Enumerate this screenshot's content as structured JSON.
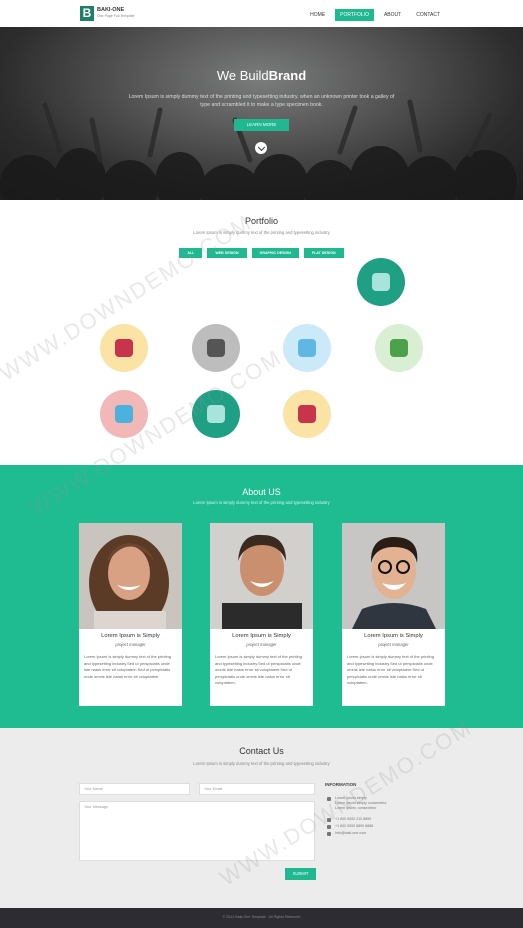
{
  "brand": {
    "letter": "B",
    "name": "BAKI-ONE",
    "tagline": "One Page Full Template"
  },
  "nav": {
    "items": [
      "HOME",
      "PORTFOLIO",
      "ABOUT",
      "CONTACT"
    ],
    "active_index": 1
  },
  "hero": {
    "title_light": "We Build",
    "title_bold": "Brand",
    "text": "Lorem Ipsum is simply dummy text of the printing and typesetting industry. when an unknown printer took a galley of type and scrambled it to make a type specimen book.",
    "button": "LEARN MORE"
  },
  "portfolio": {
    "title": "Portfolio",
    "subtitle": "Lorem Ipsum is simply dummy text of the printing and typesetting industry",
    "filters": [
      "ALL",
      "WEB DESIGN",
      "GRAPHIC DESIGN",
      "FLAT DESIGN"
    ],
    "icons": [
      {
        "name": "camera-icon",
        "bg": "#1f9f84",
        "fg": "#a9e4dc"
      },
      {
        "name": "music-icon",
        "bg": "#fbe3a6",
        "fg": "#c8344c"
      },
      {
        "name": "settings-icon",
        "bg": "#bdbdbd",
        "fg": "#555"
      },
      {
        "name": "download-icon",
        "bg": "#cbe9f8",
        "fg": "#5fb7e4"
      },
      {
        "name": "maps-icon",
        "bg": "#d9eed3",
        "fg": "#4ba24a"
      },
      {
        "name": "pie-chart-icon",
        "bg": "#f2b7b7",
        "fg": "#4ab2dc"
      },
      {
        "name": "camera-icon",
        "bg": "#1f9f84",
        "fg": "#a9e4dc"
      },
      {
        "name": "music-icon",
        "bg": "#fbe3a6",
        "fg": "#c8344c"
      }
    ]
  },
  "about": {
    "title": "About US",
    "subtitle": "Lorem Ipsum is simply dummy text of the printing and typesetting industry",
    "members": [
      {
        "name": "Lorem Ipsum is Simply",
        "role": "project manager",
        "desc": "Lorem Ipsum is simply dummy text of the printing and typesetting industry.Sed ut perspiciatis unde iste natus error sit voluptatem.Sed ut perspiciatis unde omnis iste natus error sit voluptatem."
      },
      {
        "name": "Lorem Ipsum is Simply",
        "role": "project manager",
        "desc": "Lorem Ipsum is simply dummy text of the printing and typesetting industry.Sed ut perspiciatis unde omnis iste natus error sit voluptatem.Sed ut perspiciatis unde omnis iste natus error sit voluptatem."
      },
      {
        "name": "Lorem Ipsum is Simply",
        "role": "project manager",
        "desc": "Lorem Ipsum is simply dummy text of the printing and typesetting industry.Sed ut perspiciatis unde omnis iste natus error sit voluptatem.Sed ut perspiciatis unde omnis iste natus error sit voluptatem."
      }
    ]
  },
  "contact": {
    "title": "Contact Us",
    "subtitle": "Lorem Ipsum is simply dummy text of the printing and typesetting industry",
    "name_placeholder": "Your Name",
    "email_placeholder": "Your Email",
    "message_placeholder": "Your Message",
    "submit": "SUBMIT",
    "info_title": "INFORMATION",
    "info": [
      {
        "icon": "location-icon",
        "text": "Lorem ipsum simply\nLorem ipsum simply consectetur\nLorem ipsum, consectetur"
      },
      {
        "icon": "phone-icon",
        "text": "+1 800 5000 210 8899"
      },
      {
        "icon": "fax-icon",
        "text": "+1 800 5000 8899 8888"
      },
      {
        "icon": "mail-icon",
        "text": "Info@baki-one.com"
      }
    ]
  },
  "footer": {
    "text": "© 2014 Baki-One Template · All Rights Reserved"
  },
  "watermark": "WWW.DOWNDEMO.COM"
}
